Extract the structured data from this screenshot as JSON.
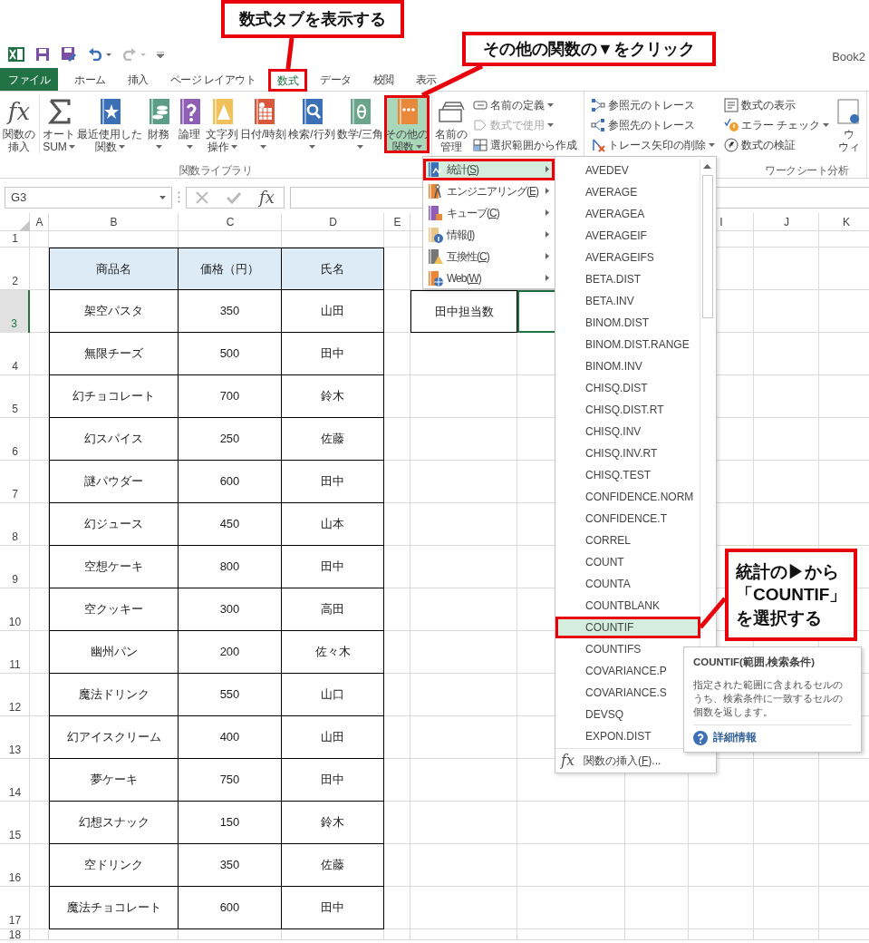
{
  "title_bar": {
    "title": "Book2"
  },
  "ribbon_tabs": [
    {
      "label": "ファイル",
      "kind": "file",
      "selected": false
    },
    {
      "label": "ホーム",
      "kind": "tab",
      "selected": false
    },
    {
      "label": "挿入",
      "kind": "tab",
      "selected": false
    },
    {
      "label": "ページ レイアウト",
      "kind": "tab",
      "selected": false
    },
    {
      "label": "数式",
      "kind": "tab",
      "selected": true
    },
    {
      "label": "データ",
      "kind": "tab",
      "selected": false
    },
    {
      "label": "校閲",
      "kind": "tab",
      "selected": false
    },
    {
      "label": "表示",
      "kind": "tab",
      "selected": false
    }
  ],
  "ribbon_groups": [
    {
      "label": "関数ライブラリ",
      "controls": [
        {
          "kind": "large",
          "glyph": "fx",
          "lines": [
            "関数の",
            "挿入"
          ],
          "dropdown": false
        },
        {
          "kind": "large",
          "lines": [
            "オート",
            "SUM"
          ],
          "dropdown": true
        },
        {
          "kind": "large",
          "lines": [
            "最近使用した",
            "関数"
          ],
          "dropdown": true
        },
        {
          "kind": "large",
          "lines": [
            "財務"
          ],
          "dropdown": true
        },
        {
          "kind": "large",
          "lines": [
            "論理"
          ],
          "dropdown": true
        },
        {
          "kind": "large",
          "lines": [
            "文字列",
            "操作"
          ],
          "dropdown": true
        },
        {
          "kind": "large",
          "lines": [
            "日付/時刻"
          ],
          "dropdown": true
        },
        {
          "kind": "large",
          "lines": [
            "検索/行列"
          ],
          "dropdown": true
        },
        {
          "kind": "large",
          "lines": [
            "数学/三角"
          ],
          "dropdown": true
        },
        {
          "kind": "large",
          "lines": [
            "その他の",
            "関数"
          ],
          "dropdown": true,
          "pressed": true
        }
      ]
    },
    {
      "controls": [
        {
          "kind": "large",
          "lines": [
            "名前の",
            "管理"
          ],
          "dropdown": false
        },
        {
          "kind": "small",
          "label": "名前の定義",
          "dropdown": true,
          "disabled": false
        },
        {
          "kind": "small",
          "label": "数式で使用",
          "dropdown": true,
          "disabled": true
        },
        {
          "kind": "small",
          "label": "選択範囲から作成",
          "dropdown": false,
          "disabled": false
        }
      ]
    },
    {
      "label": "ワークシート分析",
      "controls": [
        {
          "kind": "small",
          "label": "参照元のトレース",
          "dropdown": false,
          "disabled": false
        },
        {
          "kind": "small",
          "label": "参照先のトレース",
          "dropdown": false,
          "disabled": false
        },
        {
          "kind": "small",
          "label": "トレース矢印の削除",
          "dropdown": true,
          "disabled": false
        },
        {
          "kind": "small",
          "label": "数式の表示",
          "dropdown": false,
          "disabled": false
        },
        {
          "kind": "small",
          "label": "エラー チェック",
          "dropdown": true,
          "disabled": false
        },
        {
          "kind": "small",
          "label": "数式の検証",
          "dropdown": false,
          "disabled": false
        },
        {
          "kind": "large",
          "lines": [
            "ウ",
            "ウィ"
          ],
          "dropdown": false
        }
      ]
    }
  ],
  "formula_bar": {
    "name_box": "G3",
    "function_glyph": "fx"
  },
  "sheet": {
    "column_headers": [
      "A",
      "B",
      "C",
      "D",
      "E",
      "I",
      "J",
      "K"
    ],
    "row_numbers": [
      {
        "label": "1",
        "selected": false
      },
      {
        "label": "2",
        "selected": false
      },
      {
        "label": "3",
        "selected": true
      },
      {
        "label": "4",
        "selected": false
      },
      {
        "label": "5",
        "selected": false
      },
      {
        "label": "6",
        "selected": false
      },
      {
        "label": "7",
        "selected": false
      },
      {
        "label": "8",
        "selected": false
      },
      {
        "label": "9",
        "selected": false
      },
      {
        "label": "10",
        "selected": false
      },
      {
        "label": "11",
        "selected": false
      },
      {
        "label": "12",
        "selected": false
      },
      {
        "label": "13",
        "selected": false
      },
      {
        "label": "14",
        "selected": false
      },
      {
        "label": "15",
        "selected": false
      },
      {
        "label": "16",
        "selected": false
      },
      {
        "label": "17",
        "selected": false
      },
      {
        "label": "18",
        "selected": false
      }
    ],
    "table": {
      "columns": [
        "商品名",
        "価格（円）",
        "氏名"
      ],
      "rows": [
        [
          "架空パスタ",
          "350",
          "山田"
        ],
        [
          "無限チーズ",
          "500",
          "田中"
        ],
        [
          "幻チョコレート",
          "700",
          "鈴木"
        ],
        [
          "幻スパイス",
          "250",
          "佐藤"
        ],
        [
          "謎パウダー",
          "600",
          "田中"
        ],
        [
          "幻ジュース",
          "450",
          "山本"
        ],
        [
          "空想ケーキ",
          "800",
          "田中"
        ],
        [
          "空クッキー",
          "300",
          "高田"
        ],
        [
          "幽州パン",
          "200",
          "佐々木"
        ],
        [
          "魔法ドリンク",
          "550",
          "山口"
        ],
        [
          "幻アイスクリーム",
          "400",
          "山田"
        ],
        [
          "夢ケーキ",
          "750",
          "田中"
        ],
        [
          "幻想スナック",
          "150",
          "鈴木"
        ],
        [
          "空ドリンク",
          "350",
          "佐藤"
        ],
        [
          "魔法チョコレート",
          "600",
          "田中"
        ]
      ]
    },
    "note_cell": "田中担当数"
  },
  "category_menu": [
    {
      "prefix": "統計(",
      "key": "S",
      "suffix": ")",
      "selected": true
    },
    {
      "prefix": "エンジニアリング(",
      "key": "E",
      "suffix": ")",
      "selected": false
    },
    {
      "prefix": "キューブ(",
      "key": "C",
      "suffix": ")",
      "selected": false
    },
    {
      "prefix": "情報(",
      "key": "I",
      "suffix": ")",
      "selected": false
    },
    {
      "prefix": "互換性(",
      "key": "C",
      "suffix": ")",
      "selected": false
    },
    {
      "prefix": "Web(",
      "key": "W",
      "suffix": ")",
      "selected": false
    }
  ],
  "function_menu": {
    "items": [
      {
        "label": "AVEDEV",
        "selected": false
      },
      {
        "label": "AVERAGE",
        "selected": false
      },
      {
        "label": "AVERAGEA",
        "selected": false
      },
      {
        "label": "AVERAGEIF",
        "selected": false
      },
      {
        "label": "AVERAGEIFS",
        "selected": false
      },
      {
        "label": "BETA.DIST",
        "selected": false
      },
      {
        "label": "BETA.INV",
        "selected": false
      },
      {
        "label": "BINOM.DIST",
        "selected": false
      },
      {
        "label": "BINOM.DIST.RANGE",
        "selected": false
      },
      {
        "label": "BINOM.INV",
        "selected": false
      },
      {
        "label": "CHISQ.DIST",
        "selected": false
      },
      {
        "label": "CHISQ.DIST.RT",
        "selected": false
      },
      {
        "label": "CHISQ.INV",
        "selected": false
      },
      {
        "label": "CHISQ.INV.RT",
        "selected": false
      },
      {
        "label": "CHISQ.TEST",
        "selected": false
      },
      {
        "label": "CONFIDENCE.NORM",
        "selected": false
      },
      {
        "label": "CONFIDENCE.T",
        "selected": false
      },
      {
        "label": "CORREL",
        "selected": false
      },
      {
        "label": "COUNT",
        "selected": false
      },
      {
        "label": "COUNTA",
        "selected": false
      },
      {
        "label": "COUNTBLANK",
        "selected": false
      },
      {
        "label": "COUNTIF",
        "selected": true
      },
      {
        "label": "COUNTIFS",
        "selected": false
      },
      {
        "label": "COVARIANCE.P",
        "selected": false
      },
      {
        "label": "COVARIANCE.S",
        "selected": false
      },
      {
        "label": "DEVSQ",
        "selected": false
      },
      {
        "label": "EXPON.DIST",
        "selected": false
      }
    ],
    "footer": {
      "glyph": "fx",
      "prefix": "関数の挿入(",
      "key": "F",
      "suffix": ")..."
    }
  },
  "tooltip": {
    "title": "COUNTIF(範囲,検索条件)",
    "description": "指定された範囲に含まれるセルのうち、検索条件に一致するセルの個数を返します。",
    "link": "詳細情報"
  },
  "callouts": [
    {
      "lines": [
        "数式タブを表示する"
      ]
    },
    {
      "lines": [
        "その他の関数の▼をクリック"
      ]
    },
    {
      "lines": [
        "統計の▶から",
        "「COUNTIF」",
        "を選択する"
      ]
    }
  ]
}
